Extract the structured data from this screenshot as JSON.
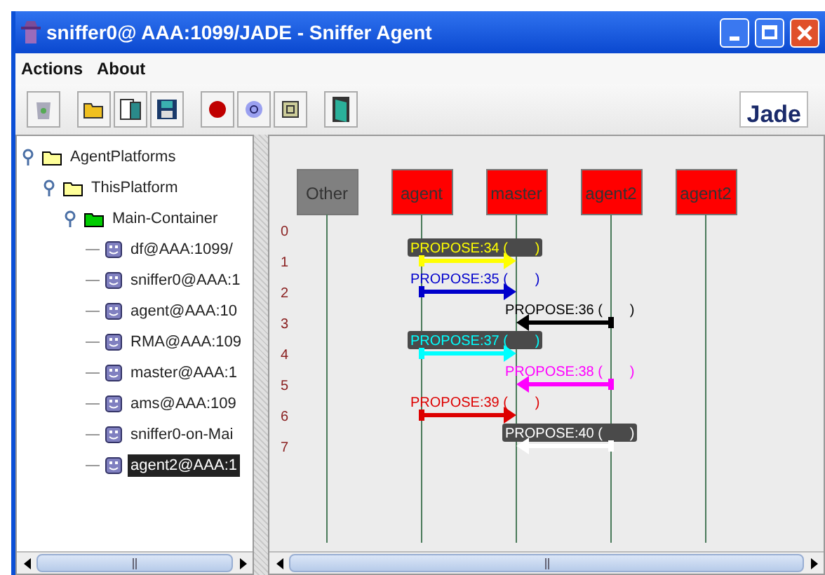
{
  "window": {
    "title": "sniffer0@ AAA:1099/JADE - Sniffer Agent"
  },
  "menu": [
    "Actions",
    "About"
  ],
  "logo": {
    "text": "Jade"
  },
  "tree": [
    {
      "label": "AgentPlatforms",
      "kind": "folder",
      "expanded": true,
      "children": [
        {
          "label": "ThisPlatform",
          "kind": "folder",
          "expanded": true,
          "children": [
            {
              "label": "Main-Container",
              "kind": "container",
              "expanded": true,
              "children": [
                {
                  "label": "df@AAA:1099/",
                  "kind": "agent",
                  "selected": false
                },
                {
                  "label": "sniffer0@AAA:1",
                  "kind": "agent",
                  "selected": false
                },
                {
                  "label": "agent@AAA:10",
                  "kind": "agent",
                  "selected": false
                },
                {
                  "label": "RMA@AAA:109",
                  "kind": "agent",
                  "selected": false
                },
                {
                  "label": "master@AAA:1",
                  "kind": "agent",
                  "selected": false
                },
                {
                  "label": "ams@AAA:109",
                  "kind": "agent",
                  "selected": false
                },
                {
                  "label": "sniffer0-on-Mai",
                  "kind": "agent",
                  "selected": false
                },
                {
                  "label": "agent2@AAA:1",
                  "kind": "agent",
                  "selected": true
                }
              ]
            }
          ]
        }
      ]
    }
  ],
  "sniffer": {
    "agents": [
      {
        "name": "Other",
        "color": "#808080"
      },
      {
        "name": "agent",
        "color": "#ff0000"
      },
      {
        "name": "master",
        "color": "#ff0000"
      },
      {
        "name": "agent2",
        "color": "#ff0000"
      },
      {
        "name": "agent2",
        "color": "#ff0000"
      }
    ],
    "rows": [
      "0",
      "1",
      "2",
      "3",
      "4",
      "5",
      "6",
      "7"
    ],
    "messages": [
      {
        "label": "PROPOSE:34 (       )",
        "color": "#ffff00"
      },
      {
        "label": "PROPOSE:35 (       )",
        "color": "#0000cc"
      },
      {
        "label": "PROPOSE:36 (       )",
        "color": "#000000"
      },
      {
        "label": "PROPOSE:37 (       )",
        "color": "#00ffff"
      },
      {
        "label": "PROPOSE:38 (       )",
        "color": "#ff00ff"
      },
      {
        "label": "PROPOSE:39 (       )",
        "color": "#dd0000"
      },
      {
        "label": "PROPOSE:40 (       )",
        "color": "#ffffff"
      }
    ]
  }
}
